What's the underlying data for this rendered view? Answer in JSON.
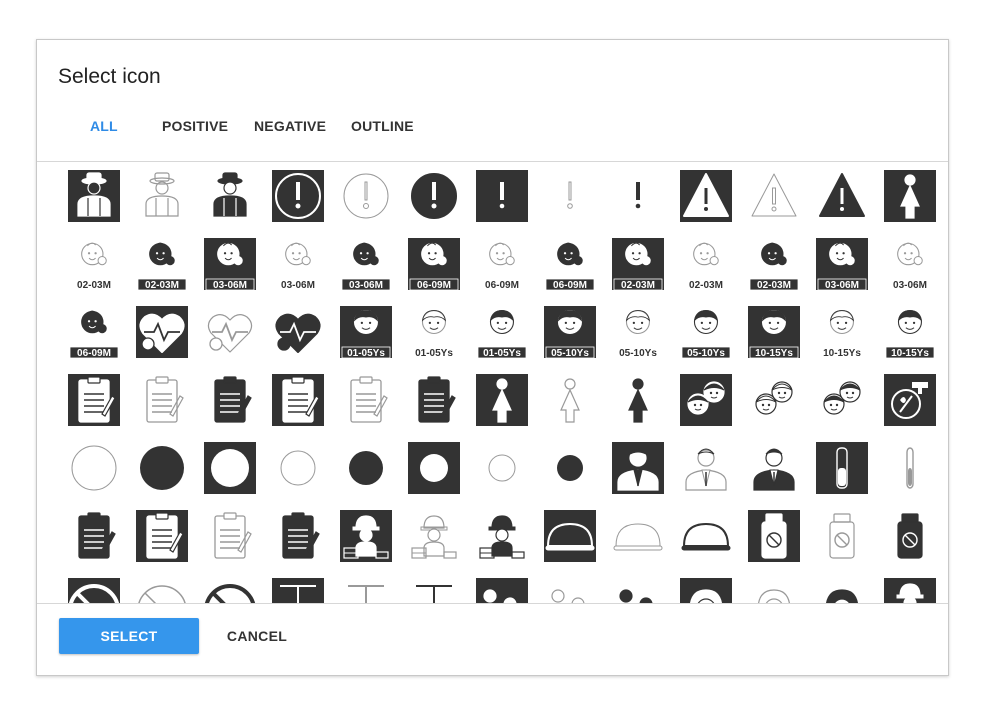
{
  "dialog": {
    "title": "Select icon",
    "tabs": [
      {
        "label": "ALL",
        "active": true
      },
      {
        "label": "POSITIVE",
        "active": false
      },
      {
        "label": "NEGATIVE",
        "active": false
      },
      {
        "label": "OUTLINE",
        "active": false
      }
    ],
    "select_label": "SELECT",
    "cancel_label": "CANCEL"
  },
  "colors": {
    "accent": "#2f8be6",
    "button": "#3596ec",
    "icon_dark": "#333333",
    "icon_outline": "#999999"
  },
  "icons": [
    {
      "name": "farmer-icon",
      "shape": "person",
      "style": "positive"
    },
    {
      "name": "farmer-icon",
      "shape": "person",
      "style": "outline"
    },
    {
      "name": "farmer-icon",
      "shape": "person",
      "style": "negative"
    },
    {
      "name": "alert-icon",
      "shape": "exclaim-circle",
      "style": "positive"
    },
    {
      "name": "alert-icon",
      "shape": "exclaim-circle",
      "style": "outline"
    },
    {
      "name": "alert-icon",
      "shape": "exclaim-circle",
      "style": "negative"
    },
    {
      "name": "exclamation-icon",
      "shape": "exclaim",
      "style": "positive"
    },
    {
      "name": "exclamation-icon",
      "shape": "exclaim",
      "style": "outline"
    },
    {
      "name": "exclamation-icon",
      "shape": "exclaim",
      "style": "negative"
    },
    {
      "name": "warning-icon",
      "shape": "triangle",
      "style": "positive"
    },
    {
      "name": "warning-icon",
      "shape": "triangle",
      "style": "outline"
    },
    {
      "name": "warning-icon",
      "shape": "triangle",
      "style": "negative"
    },
    {
      "name": "pregnancy-icon",
      "shape": "woman",
      "style": "positive"
    },
    {
      "name": "baby-icon",
      "shape": "baby",
      "style": "outline",
      "label": "02-03M"
    },
    {
      "name": "baby-icon",
      "shape": "baby",
      "style": "negative",
      "label": "02-03M"
    },
    {
      "name": "baby-icon",
      "shape": "baby",
      "style": "positive",
      "label": "03-06M"
    },
    {
      "name": "baby-icon",
      "shape": "baby",
      "style": "outline",
      "label": "03-06M"
    },
    {
      "name": "baby-icon",
      "shape": "baby",
      "style": "negative",
      "label": "03-06M"
    },
    {
      "name": "baby-icon",
      "shape": "baby",
      "style": "positive",
      "label": "06-09M"
    },
    {
      "name": "baby-icon",
      "shape": "baby",
      "style": "outline",
      "label": "06-09M"
    },
    {
      "name": "baby-icon",
      "shape": "baby",
      "style": "negative",
      "label": "06-09M"
    },
    {
      "name": "baby-icon",
      "shape": "baby",
      "style": "positive",
      "label": "02-03M"
    },
    {
      "name": "baby-icon",
      "shape": "baby",
      "style": "outline",
      "label": "02-03M"
    },
    {
      "name": "baby-icon",
      "shape": "baby",
      "style": "negative",
      "label": "02-03M"
    },
    {
      "name": "baby-icon",
      "shape": "baby",
      "style": "positive",
      "label": "03-06M"
    },
    {
      "name": "baby-icon",
      "shape": "baby",
      "style": "outline",
      "label": "03-06M"
    },
    {
      "name": "baby-icon",
      "shape": "baby",
      "style": "negative",
      "label": "06-09M"
    },
    {
      "name": "heart-monitor-icon",
      "shape": "heart",
      "style": "positive"
    },
    {
      "name": "heart-monitor-icon",
      "shape": "heart",
      "style": "outline"
    },
    {
      "name": "heart-monitor-icon",
      "shape": "heart",
      "style": "negative"
    },
    {
      "name": "child-icon",
      "shape": "child",
      "style": "positive",
      "label": "01-05Ys"
    },
    {
      "name": "child-icon",
      "shape": "child",
      "style": "outline",
      "label": "01-05Ys"
    },
    {
      "name": "child-icon",
      "shape": "child",
      "style": "negative",
      "label": "01-05Ys"
    },
    {
      "name": "child-icon",
      "shape": "child",
      "style": "positive",
      "label": "05-10Ys"
    },
    {
      "name": "child-icon",
      "shape": "child",
      "style": "outline",
      "label": "05-10Ys"
    },
    {
      "name": "child-icon",
      "shape": "child",
      "style": "negative",
      "label": "05-10Ys"
    },
    {
      "name": "child-icon",
      "shape": "child",
      "style": "positive",
      "label": "10-15Ys"
    },
    {
      "name": "child-icon",
      "shape": "child",
      "style": "outline",
      "label": "10-15Ys"
    },
    {
      "name": "child-icon",
      "shape": "child",
      "style": "negative",
      "label": "10-15Ys"
    },
    {
      "name": "clipboard-icon",
      "shape": "clipboard",
      "style": "positive"
    },
    {
      "name": "clipboard-icon",
      "shape": "clipboard",
      "style": "outline"
    },
    {
      "name": "clipboard-icon",
      "shape": "clipboard",
      "style": "negative"
    },
    {
      "name": "clipboard-icon",
      "shape": "clipboard",
      "style": "positive"
    },
    {
      "name": "clipboard-icon",
      "shape": "clipboard",
      "style": "outline"
    },
    {
      "name": "clipboard-icon",
      "shape": "clipboard",
      "style": "negative"
    },
    {
      "name": "woman-icon",
      "shape": "woman",
      "style": "positive"
    },
    {
      "name": "woman-icon",
      "shape": "woman",
      "style": "outline"
    },
    {
      "name": "woman-icon",
      "shape": "woman",
      "style": "negative"
    },
    {
      "name": "children-icon",
      "shape": "kids",
      "style": "positive"
    },
    {
      "name": "children-icon",
      "shape": "kids",
      "style": "outline"
    },
    {
      "name": "children-icon",
      "shape": "kids",
      "style": "negative"
    },
    {
      "name": "tap-water-icon",
      "shape": "tap",
      "style": "positive"
    },
    {
      "name": "circle-icon",
      "shape": "circle-l",
      "style": "outline"
    },
    {
      "name": "circle-icon",
      "shape": "circle-l",
      "style": "negative"
    },
    {
      "name": "circle-icon",
      "shape": "circle-l",
      "style": "positive"
    },
    {
      "name": "circle-icon",
      "shape": "circle-m",
      "style": "outline"
    },
    {
      "name": "circle-icon",
      "shape": "circle-m",
      "style": "negative"
    },
    {
      "name": "circle-icon",
      "shape": "circle-m",
      "style": "positive"
    },
    {
      "name": "circle-icon",
      "shape": "circle-s",
      "style": "outline"
    },
    {
      "name": "circle-icon",
      "shape": "circle-s",
      "style": "negative"
    },
    {
      "name": "businessman-icon",
      "shape": "suit",
      "style": "positive"
    },
    {
      "name": "businessman-icon",
      "shape": "suit",
      "style": "outline"
    },
    {
      "name": "businessman-icon",
      "shape": "suit",
      "style": "negative"
    },
    {
      "name": "test-tube-icon",
      "shape": "tube",
      "style": "positive"
    },
    {
      "name": "test-tube-icon",
      "shape": "tube",
      "style": "outline"
    },
    {
      "name": "clipboard-icon",
      "shape": "clipboard",
      "style": "negative"
    },
    {
      "name": "clipboard-icon",
      "shape": "clipboard",
      "style": "positive"
    },
    {
      "name": "clipboard-icon",
      "shape": "clipboard",
      "style": "outline"
    },
    {
      "name": "clipboard-icon",
      "shape": "clipboard",
      "style": "negative"
    },
    {
      "name": "construction-worker-icon",
      "shape": "worker",
      "style": "positive"
    },
    {
      "name": "construction-worker-icon",
      "shape": "worker",
      "style": "outline"
    },
    {
      "name": "construction-worker-icon",
      "shape": "worker",
      "style": "negative"
    },
    {
      "name": "dome-icon",
      "shape": "dome",
      "style": "positive"
    },
    {
      "name": "dome-icon",
      "shape": "dome",
      "style": "outline"
    },
    {
      "name": "dome-icon",
      "shape": "dome",
      "style": "negative"
    },
    {
      "name": "medicine-bottle-icon",
      "shape": "bottle",
      "style": "positive"
    },
    {
      "name": "medicine-bottle-icon",
      "shape": "bottle",
      "style": "outline"
    },
    {
      "name": "medicine-bottle-icon",
      "shape": "bottle",
      "style": "negative"
    },
    {
      "name": "no-food-icon",
      "shape": "nofood",
      "style": "positive"
    },
    {
      "name": "no-food-icon",
      "shape": "nofood",
      "style": "outline"
    },
    {
      "name": "no-food-icon",
      "shape": "nofood",
      "style": "negative"
    },
    {
      "name": "iud-icon",
      "shape": "iud",
      "style": "positive"
    },
    {
      "name": "iud-icon",
      "shape": "iud",
      "style": "outline"
    },
    {
      "name": "iud-icon",
      "shape": "iud",
      "style": "negative"
    },
    {
      "name": "family-icon",
      "shape": "family",
      "style": "positive"
    },
    {
      "name": "family-icon",
      "shape": "family",
      "style": "outline"
    },
    {
      "name": "family-icon",
      "shape": "family",
      "style": "negative"
    },
    {
      "name": "woman-face-icon",
      "shape": "face",
      "style": "positive"
    },
    {
      "name": "woman-face-icon",
      "shape": "face",
      "style": "outline"
    },
    {
      "name": "woman-face-icon",
      "shape": "face",
      "style": "negative"
    },
    {
      "name": "construction-worker-icon",
      "shape": "worker",
      "style": "positive"
    }
  ]
}
